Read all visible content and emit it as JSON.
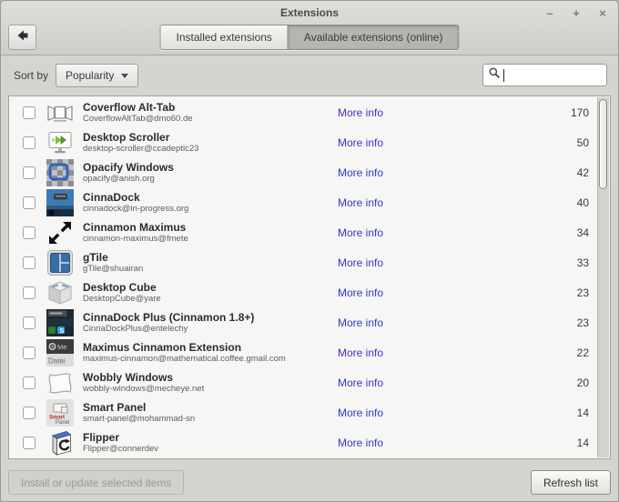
{
  "window": {
    "title": "Extensions",
    "controls": {
      "minimize": "–",
      "maximize": "+",
      "close": "×"
    }
  },
  "tabs": [
    {
      "label": "Installed extensions",
      "active": false
    },
    {
      "label": "Available extensions (online)",
      "active": true
    }
  ],
  "toolbar": {
    "sort_label": "Sort by",
    "sort_value": "Popularity",
    "search_value": "",
    "search_icon": "search-icon"
  },
  "list": {
    "extensions": [
      {
        "name": "Coverflow Alt-Tab",
        "uuid": "CoverflowAltTab@dmo60.de",
        "more_info": "More info",
        "count": 170,
        "icon": "coverflow-alt-tab-icon"
      },
      {
        "name": "Desktop Scroller",
        "uuid": "desktop-scroller@ccadeptic23",
        "more_info": "More info",
        "count": 50,
        "icon": "desktop-scroller-icon"
      },
      {
        "name": "Opacify Windows",
        "uuid": "opacify@anish.org",
        "more_info": "More info",
        "count": 42,
        "icon": "opacify-windows-icon"
      },
      {
        "name": "CinnaDock",
        "uuid": "cinnadock@in-progress.org",
        "more_info": "More info",
        "count": 40,
        "icon": "cinnadock-icon"
      },
      {
        "name": "Cinnamon Maximus",
        "uuid": "cinnamon-maximus@fmete",
        "more_info": "More info",
        "count": 34,
        "icon": "cinnamon-maximus-icon"
      },
      {
        "name": "gTile",
        "uuid": "gTile@shuairan",
        "more_info": "More info",
        "count": 33,
        "icon": "gtile-icon"
      },
      {
        "name": "Desktop Cube",
        "uuid": "DesktopCube@yare",
        "more_info": "More info",
        "count": 23,
        "icon": "desktop-cube-icon"
      },
      {
        "name": "CinnaDock Plus (Cinnamon 1.8+)",
        "uuid": "CinnaDockPlus@entelechy",
        "more_info": "More info",
        "count": 23,
        "icon": "cinnadock-plus-icon"
      },
      {
        "name": "Maximus Cinnamon Extension",
        "uuid": "maximus-cinnamon@mathematical.coffee.gmail.com",
        "more_info": "More info",
        "count": 22,
        "icon": "maximus-cinnamon-icon"
      },
      {
        "name": "Wobbly Windows",
        "uuid": "wobbly-windows@mecheye.net",
        "more_info": "More info",
        "count": 20,
        "icon": "wobbly-windows-icon"
      },
      {
        "name": "Smart Panel",
        "uuid": "smart-panel@mohammad-sn",
        "more_info": "More info",
        "count": 14,
        "icon": "smart-panel-icon"
      },
      {
        "name": "Flipper",
        "uuid": "Flipper@connerdev",
        "more_info": "More info",
        "count": 14,
        "icon": "flipper-icon"
      }
    ]
  },
  "footer": {
    "install_label": "Install or update selected items",
    "refresh_label": "Refresh list"
  },
  "colors": {
    "link": "#3734cf",
    "window_bg": "#d6d4d1",
    "list_bg": "#f6f6f5"
  }
}
